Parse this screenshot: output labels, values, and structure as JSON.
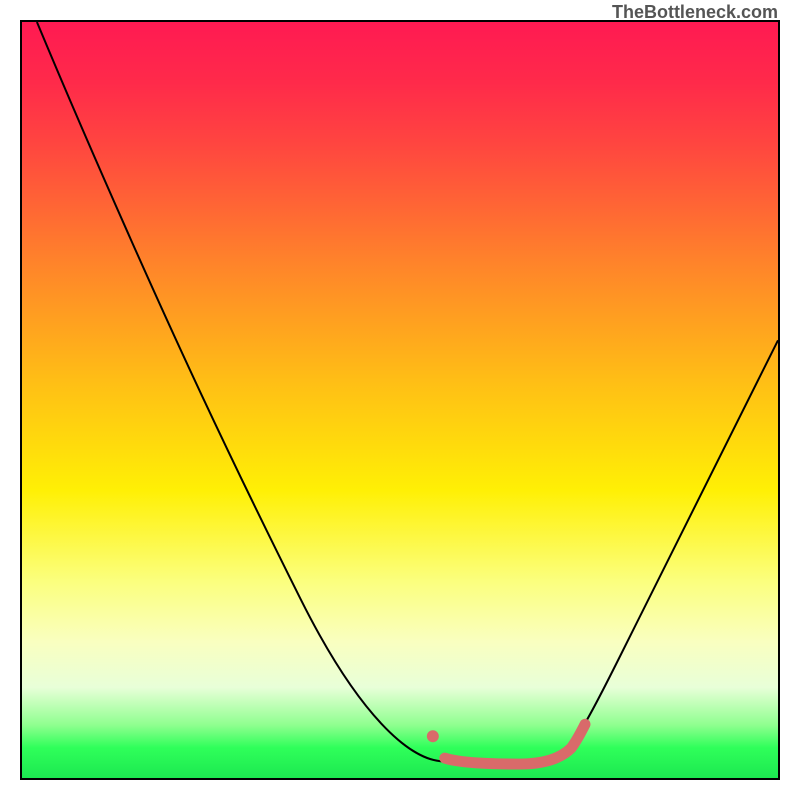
{
  "watermark": "TheBottleneck.com",
  "chart_data": {
    "type": "line",
    "title": "",
    "xlabel": "",
    "ylabel": "",
    "xlim": [
      0,
      100
    ],
    "ylim": [
      0,
      100
    ],
    "series": [
      {
        "name": "curve",
        "color": "#000000",
        "x": [
          2,
          10,
          20,
          30,
          40,
          50,
          55,
          58,
          62,
          66,
          70,
          74,
          78,
          82,
          86,
          90,
          95,
          100
        ],
        "y": [
          100,
          86,
          69,
          52,
          35,
          18,
          9,
          4,
          2,
          2,
          2,
          4,
          10,
          18,
          27,
          36,
          47,
          58
        ]
      },
      {
        "name": "highlight",
        "color": "#d96a6a",
        "x": [
          55,
          58,
          62,
          66,
          70,
          74
        ],
        "y": [
          9,
          4,
          2,
          2,
          2,
          4
        ]
      }
    ],
    "annotations": []
  }
}
